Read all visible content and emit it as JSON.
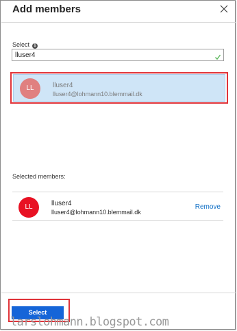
{
  "header": {
    "title": "Add members",
    "close_icon": "close-icon"
  },
  "search": {
    "label": "Select",
    "info_icon_glyph": "i",
    "value": "lluser4",
    "valid_icon": "check-icon",
    "valid_color": "#5cb85c"
  },
  "search_results": [
    {
      "initials": "LL",
      "name": "lluser4",
      "email": "lluser4@lohmann10.blemmail.dk",
      "avatar_color": "#e08080"
    }
  ],
  "selected": {
    "label": "Selected members:",
    "members": [
      {
        "initials": "LL",
        "name": "lluser4",
        "email": "lluser4@lohmann10.blemmail.dk",
        "avatar_color": "#e81123",
        "remove_label": "Remove"
      }
    ]
  },
  "footer": {
    "select_label": "Select",
    "button_color": "#1565d8"
  },
  "watermark": "larslohmann.blogspot.com",
  "colors": {
    "highlight_border": "#e0343a",
    "selection_bg": "#cfe5f7",
    "link": "#0f6fc6"
  }
}
